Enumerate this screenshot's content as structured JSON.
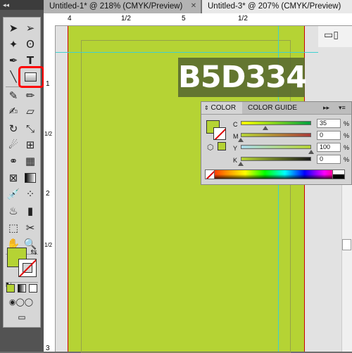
{
  "tabs": [
    {
      "label": "Untitled-1* @ 218% (CMYK/Preview)",
      "close": "✕"
    },
    {
      "label": "Untitled-3* @ 207% (CMYK/Preview)",
      "close": "✕"
    }
  ],
  "toolbox": {
    "collapse": "◂◂",
    "tools": [
      "selection-tool",
      "direct-selection-tool",
      "magic-wand-tool",
      "lasso-tool",
      "pen-tool",
      "type-tool",
      "line-tool",
      "rectangle-tool",
      "paintbrush-tool",
      "pencil-tool",
      "blob-brush-tool",
      "eraser-tool",
      "rotate-tool",
      "scale-tool",
      "warp-tool",
      "free-transform-tool",
      "shape-builder-tool",
      "perspective-grid-tool",
      "mesh-tool",
      "gradient-tool",
      "eyedropper-tool",
      "blend-tool",
      "symbol-sprayer-tool",
      "column-graph-tool",
      "artboard-tool",
      "slice-tool",
      "hand-tool",
      "zoom-tool"
    ],
    "type_glyph": "T"
  },
  "ruler": {
    "top_labels": [
      "4",
      "1/2",
      "5",
      "1/2"
    ],
    "left_labels": [
      "1",
      "1/2",
      "2",
      "1/2",
      "3"
    ]
  },
  "hex_overlay": "B5D334",
  "fill_color": "#b5d334",
  "color_panel": {
    "tab_color": "COLOR",
    "tab_guide": "COLOR GUIDE",
    "menu_expand": "▸▸",
    "menu_options": "▾≡",
    "channels": [
      {
        "label": "C",
        "value": "35",
        "unit": "%",
        "position": 0.35
      },
      {
        "label": "M",
        "value": "0",
        "unit": "%",
        "position": 0.0
      },
      {
        "label": "Y",
        "value": "100",
        "unit": "%",
        "position": 1.0
      },
      {
        "label": "K",
        "value": "0",
        "unit": "%",
        "position": 0.0
      }
    ]
  },
  "right_strip": {
    "icon": "▭▯"
  }
}
